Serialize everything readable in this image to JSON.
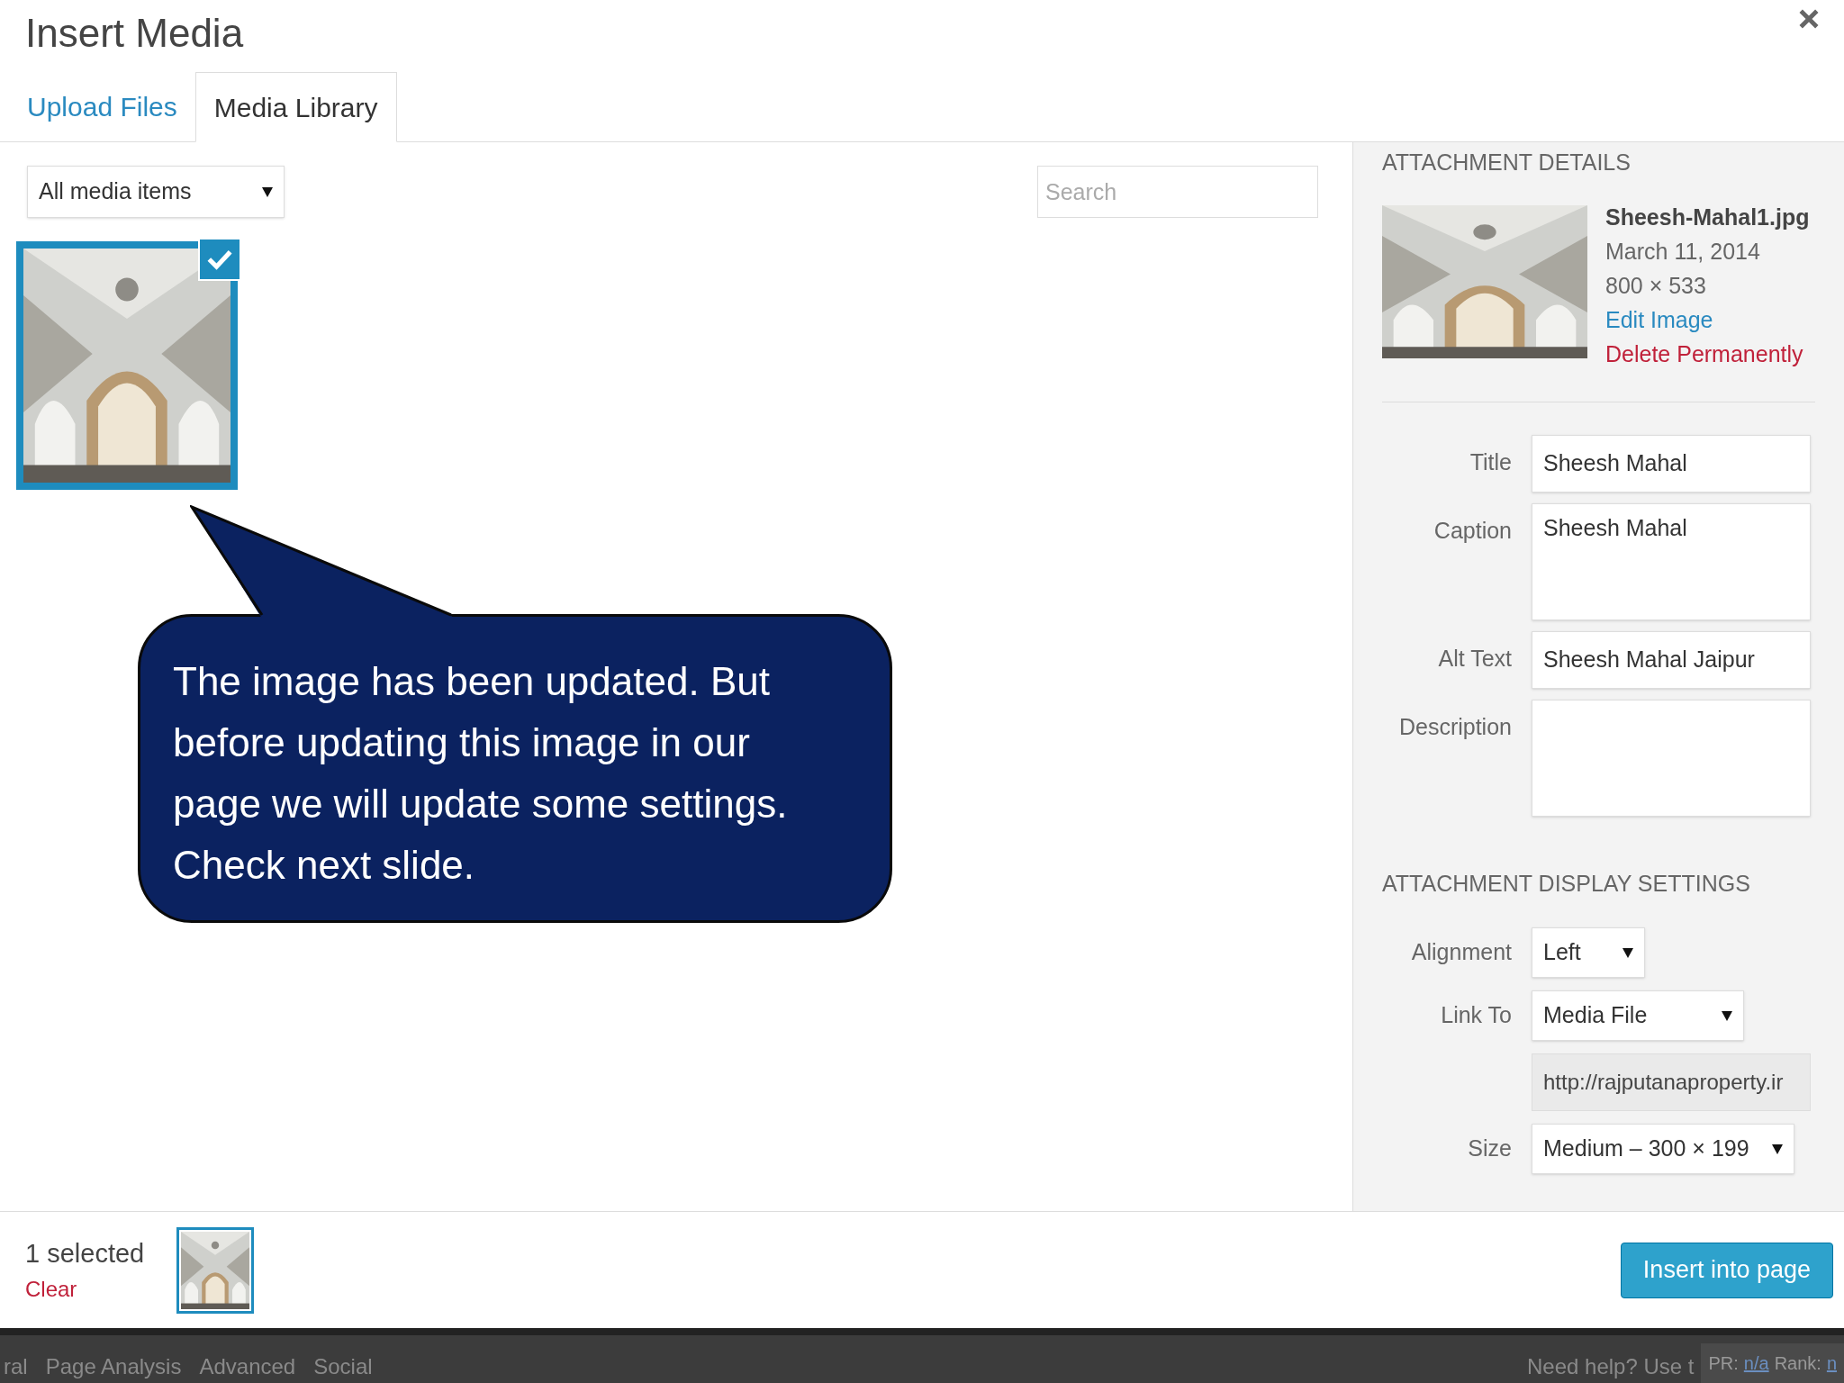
{
  "dialog": {
    "title": "Insert Media",
    "tabs": [
      {
        "label": "Upload Files",
        "selected": false
      },
      {
        "label": "Media Library",
        "selected": true
      }
    ],
    "filter": {
      "value": "All media items"
    },
    "search": {
      "placeholder": "Search"
    },
    "media_items": [
      {
        "kind": "picture",
        "selected": true
      }
    ],
    "details": {
      "heading": "ATTACHMENT DETAILS",
      "filename": "Sheesh-Mahal1.jpg",
      "date": "March 11, 2014",
      "dimensions": "800 × 533",
      "edit_link": "Edit Image",
      "delete_link": "Delete Permanently",
      "fields": [
        {
          "label": "Title",
          "value": "Sheesh Mahal",
          "kind": "input"
        },
        {
          "label": "Caption",
          "value": "Sheesh Mahal",
          "kind": "textarea"
        },
        {
          "label": "Alt Text",
          "value": "Sheesh Mahal Jaipur",
          "kind": "input"
        },
        {
          "label": "Description",
          "kind": "textarea"
        }
      ]
    },
    "display_settings": {
      "heading": "ATTACHMENT DISPLAY SETTINGS",
      "alignment": {
        "label": "Alignment",
        "value": "Left"
      },
      "link_to": {
        "label": "Link To",
        "value": "Media File"
      },
      "url": "http://rajputanaproperty.ir",
      "size": {
        "label": "Size",
        "value": "Medium – 300 × 199"
      }
    },
    "footer": {
      "selected_count": "1 selected",
      "clear": "Clear",
      "button": "Insert into page"
    }
  },
  "background_bar": {
    "tabs": [
      "ral",
      "Page Analysis",
      "Advanced",
      "Social"
    ],
    "help": "Need help? Use t",
    "pr_label": "PR:",
    "pr_value": "n/a",
    "rank_label": "Rank:",
    "rank_value": "n"
  },
  "callout": {
    "text": "The image has been updated. But before updating this image in our page we will update some settings. Check next slide."
  }
}
